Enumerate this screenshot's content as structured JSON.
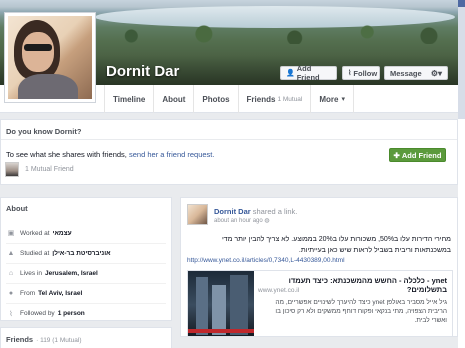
{
  "profile": {
    "name": "Dornit Dar"
  },
  "cover_buttons": {
    "add_friend": "Add Friend",
    "follow": "Follow",
    "message": "Message"
  },
  "tabs": [
    {
      "label": "Timeline",
      "sub": ""
    },
    {
      "label": "About",
      "sub": ""
    },
    {
      "label": "Photos",
      "sub": ""
    },
    {
      "label": "Friends",
      "sub": "1 Mutual"
    },
    {
      "label": "More",
      "sub": "▾"
    }
  ],
  "know": {
    "title": "Do you know Dornit?",
    "text": "To see what she shares with friends,",
    "link": "send her a friend request.",
    "button": "Add Friend",
    "mutual": "1 Mutual Friend"
  },
  "about": {
    "title": "About",
    "items": [
      {
        "icon": "briefcase-icon",
        "prefix": "Worked at",
        "value": "עצמאי"
      },
      {
        "icon": "graduation-icon",
        "prefix": "Studied at",
        "value": "אוניברסיטת בר-אילן"
      },
      {
        "icon": "house-icon",
        "prefix": "Lives in",
        "value": "Jerusalem, Israel"
      },
      {
        "icon": "pin-icon",
        "prefix": "From",
        "value": "Tel Aviv, Israel"
      },
      {
        "icon": "rss-icon",
        "prefix": "Followed by",
        "value": "1 person"
      }
    ]
  },
  "friends": {
    "title": "Friends",
    "count": "· 119 (1 Mutual)"
  },
  "post": {
    "author": "Dornit Dar",
    "action": "shared a link.",
    "time": "about an hour ago",
    "text": "מחירי הדירות עלו ב50%, משכורות עלו ב20% בממוצע. לא צריך להבין יותר מדי במשכנתאות וריבית בשביל לראות שיש כאן בעייתיות.",
    "link": "http://www.ynet.co.il/articles/0,7340,L-4430389,00.html",
    "share_title": "ynet - כלכלה - החשש מהמשכנתא: כיצד תעמדו בתשלומים?",
    "share_source": "www.ynet.co.il",
    "share_desc": "גיל אייל מסביר באולפן ynet כיצד להיערך לשינויים אפשריים, מה הריבית הצפויה, מתי בנקאי ופקוח דוחף ממשקים ולא רק סיכון בו ואשרי לבית."
  }
}
